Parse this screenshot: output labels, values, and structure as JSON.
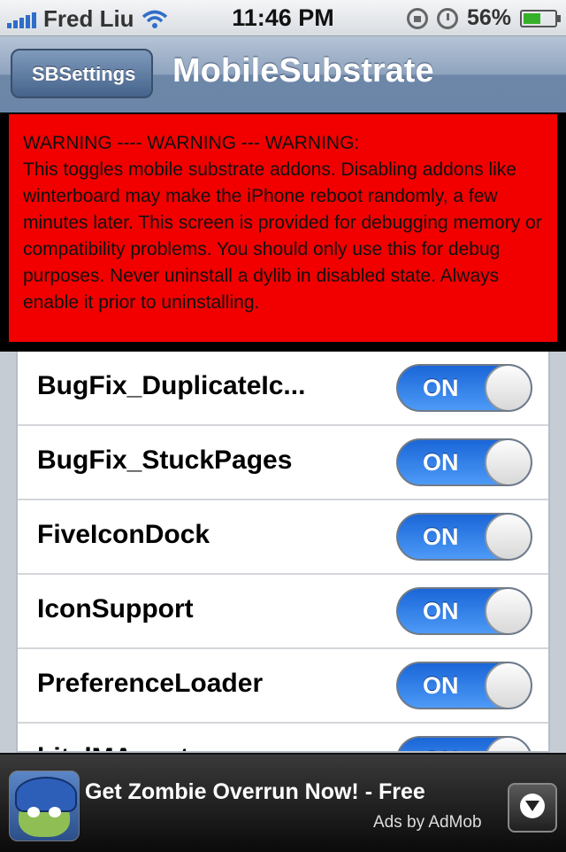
{
  "status_bar": {
    "carrier": "Fred Liu",
    "time": "11:46 PM",
    "battery": "56%",
    "battery_level": 0.56,
    "icons": [
      "signal-icon",
      "wifi-icon",
      "rotation-lock-icon",
      "alarm-icon",
      "battery-icon"
    ]
  },
  "nav": {
    "back_label": "SBSettings",
    "title": "MobileSubstrate"
  },
  "warning": {
    "heading": "WARNING ---- WARNING --- WARNING:",
    "body": "This toggles mobile substrate addons. Disabling addons like winterboard may make the iPhone reboot randomly, a few minutes later. This screen is provided for debugging memory or compatibility problems. You should only use this for debug purposes. Never uninstall a dylib in disabled state. Always enable it prior to uninstalling.",
    "color": "#f20000"
  },
  "list": {
    "items": [
      {
        "label": "BugFix_DuplicateIc...",
        "switch_text": "ON"
      },
      {
        "label": "BugFix_StuckPages",
        "switch_text": "ON"
      },
      {
        "label": "FiveIconDock",
        "switch_text": "ON"
      },
      {
        "label": "IconSupport",
        "switch_text": "ON"
      },
      {
        "label": "PreferenceLoader",
        "switch_text": "ON"
      },
      {
        "label": "bitelMAgent",
        "switch_text": "ON"
      }
    ]
  },
  "ad": {
    "title": "Get Zombie Overrun Now! - Free",
    "subtitle": "Ads by AdMob"
  }
}
